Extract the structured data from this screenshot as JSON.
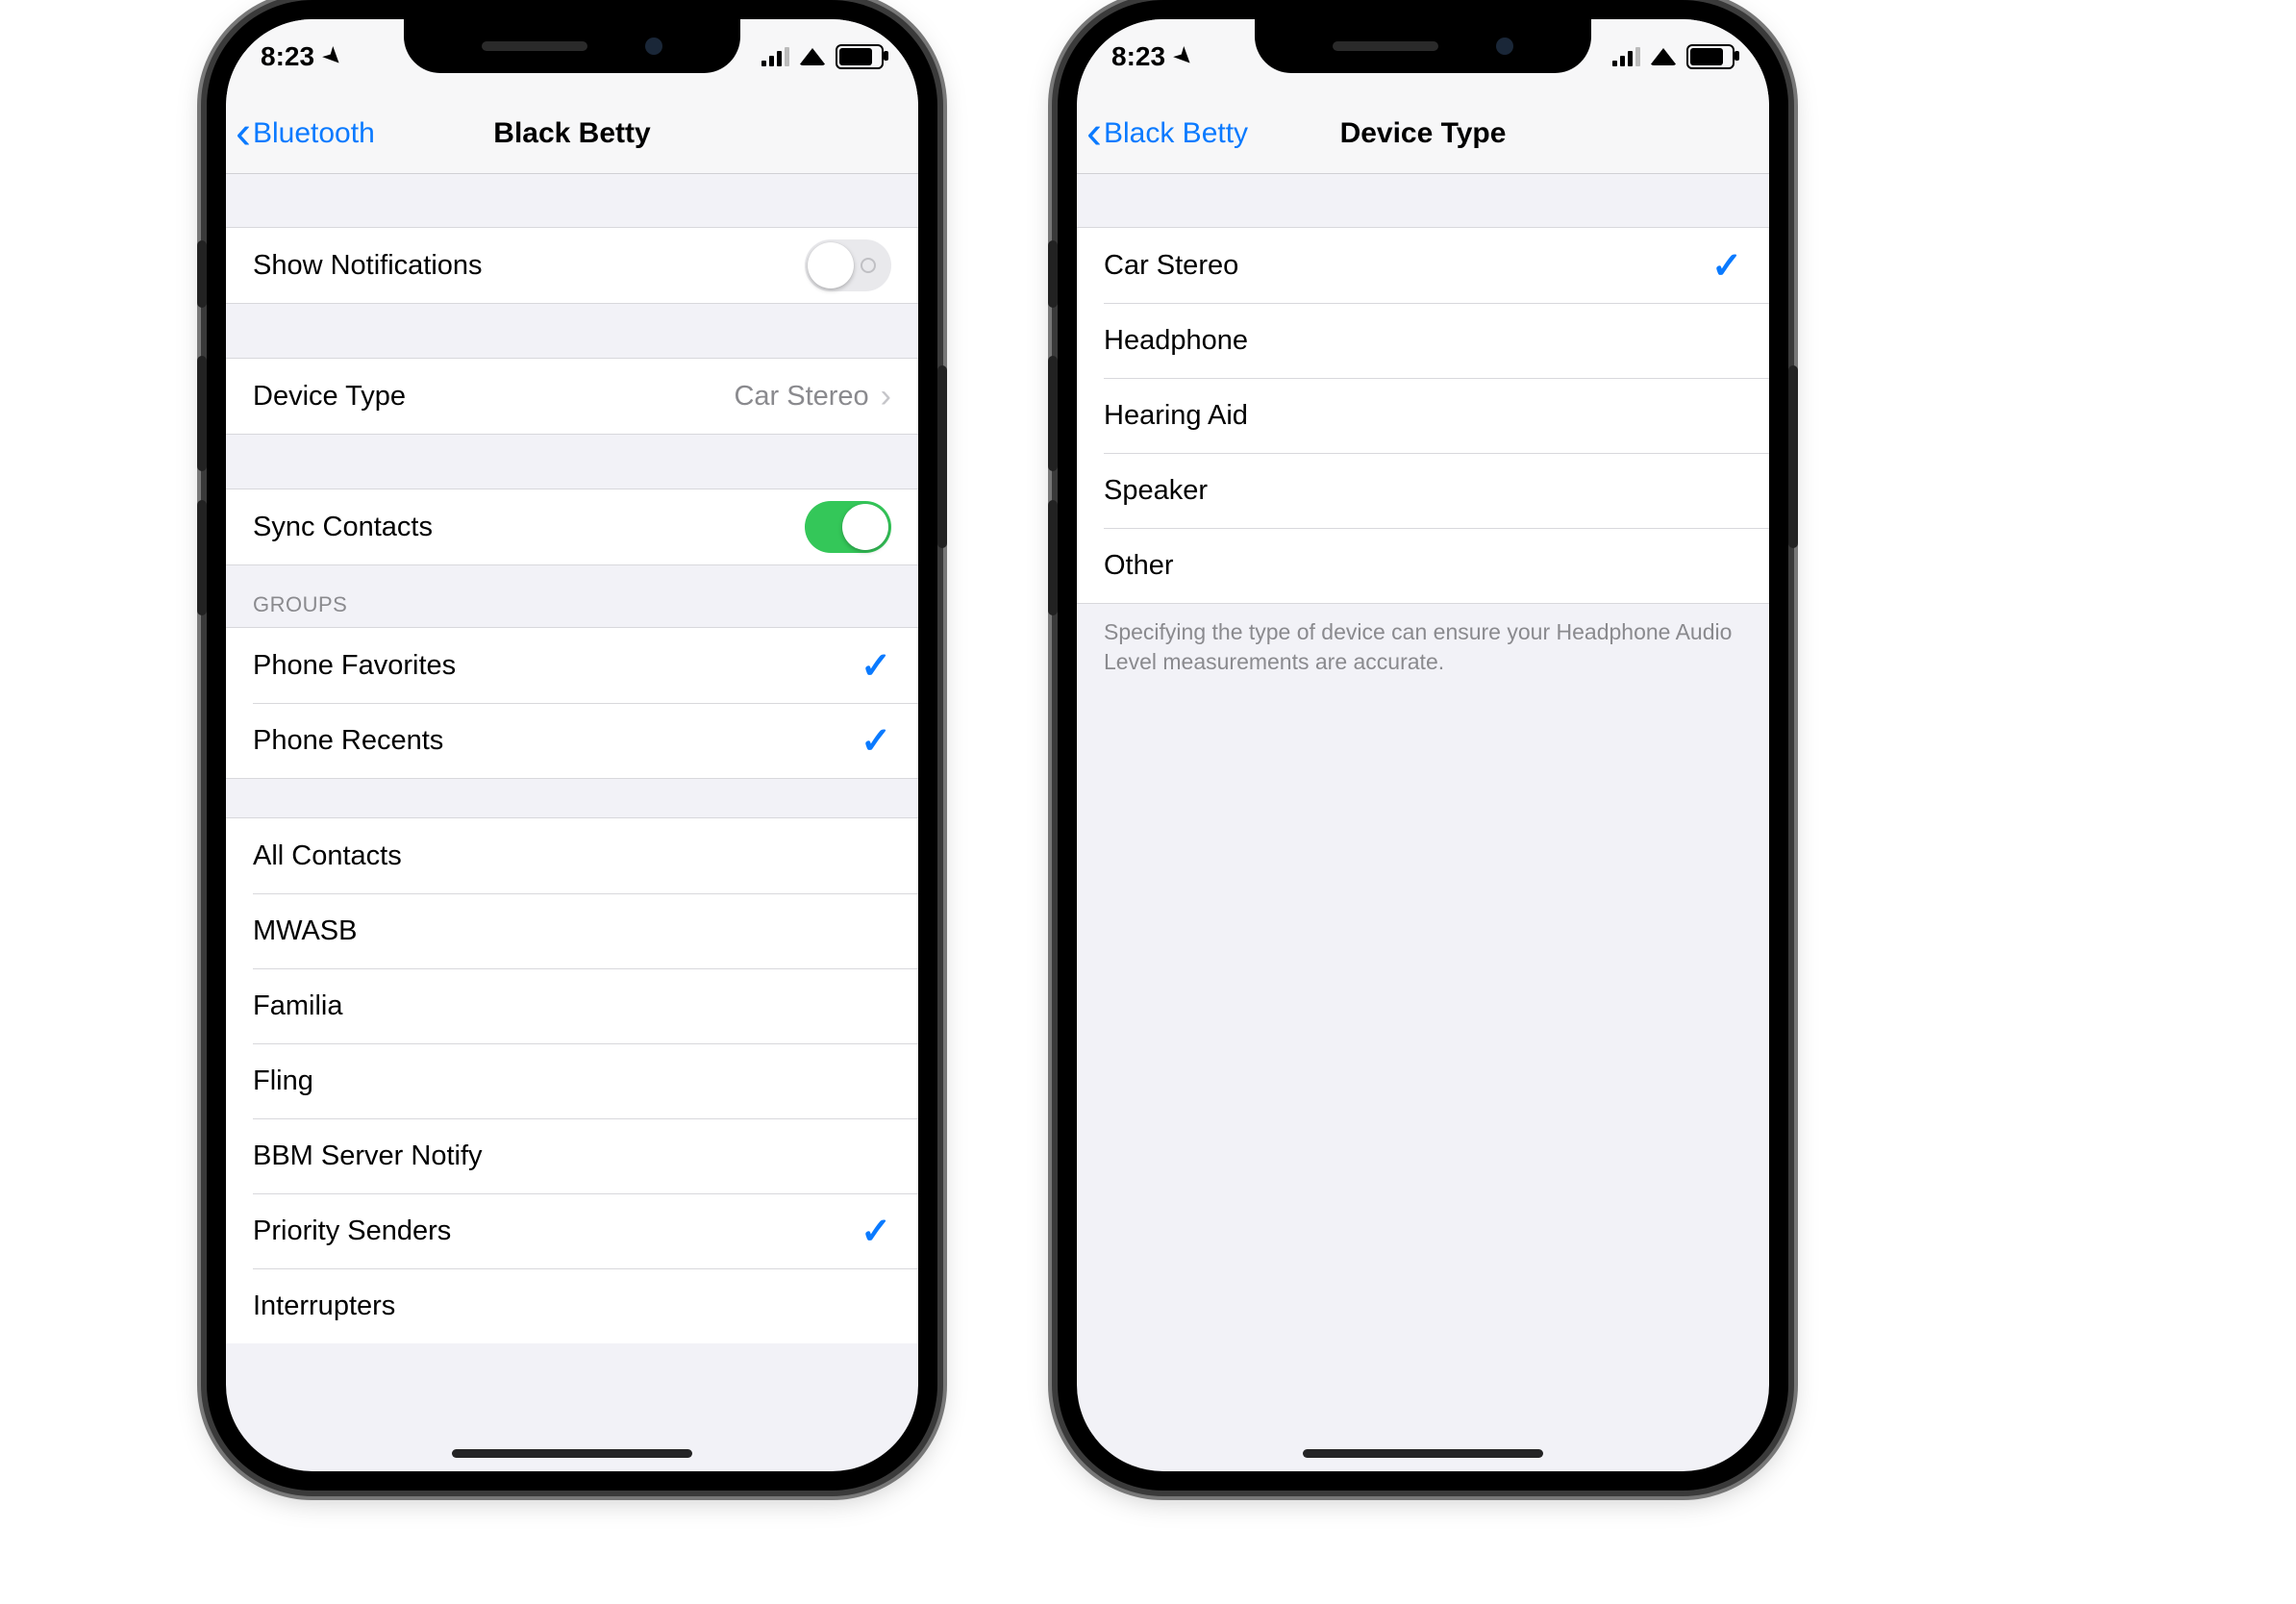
{
  "status": {
    "time": "8:23"
  },
  "left": {
    "back": "Bluetooth",
    "title": "Black Betty",
    "show_notifications_label": "Show Notifications",
    "show_notifications_on": false,
    "device_type_label": "Device Type",
    "device_type_value": "Car Stereo",
    "sync_contacts_label": "Sync Contacts",
    "sync_contacts_on": true,
    "groups_header": "GROUPS",
    "groups_top": [
      {
        "label": "Phone Favorites",
        "checked": true
      },
      {
        "label": "Phone Recents",
        "checked": true
      }
    ],
    "groups_bottom": [
      {
        "label": "All Contacts",
        "checked": false
      },
      {
        "label": "MWASB",
        "checked": false
      },
      {
        "label": "Familia",
        "checked": false
      },
      {
        "label": "Fling",
        "checked": false
      },
      {
        "label": "BBM Server Notify",
        "checked": false
      },
      {
        "label": "Priority Senders",
        "checked": true
      },
      {
        "label": "Interrupters",
        "checked": false
      }
    ]
  },
  "right": {
    "back": "Black Betty",
    "title": "Device Type",
    "options": [
      {
        "label": "Car Stereo",
        "selected": true
      },
      {
        "label": "Headphone",
        "selected": false
      },
      {
        "label": "Hearing Aid",
        "selected": false
      },
      {
        "label": "Speaker",
        "selected": false
      },
      {
        "label": "Other",
        "selected": false
      }
    ],
    "footer": "Specifying the type of device can ensure your Headphone Audio Level measurements are accurate."
  }
}
